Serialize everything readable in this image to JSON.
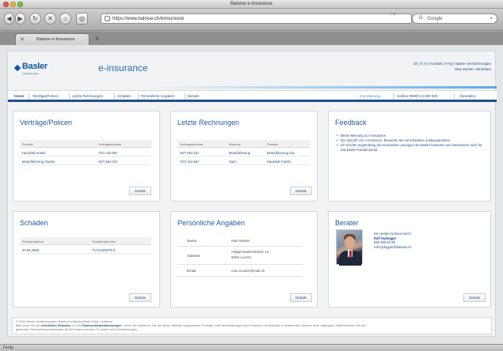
{
  "window": {
    "title": "Baloise e-Insurance"
  },
  "toolbar": {
    "url": "https://www.baloise.ch/einsurance",
    "search_engine": "G",
    "search_placeholder": "Google"
  },
  "tab": {
    "label": "Baloise e-Insurance"
  },
  "site": {
    "logo_word": "Basler",
    "logo_sub": "Versicherungen",
    "brand_title": "e-insurance",
    "toplinks_line1": "de | fr | it | Kontakt | FAQ | Basler Versicherungen",
    "toplinks_line2": "Max Muster, Abmelden"
  },
  "nav": {
    "items": [
      "Home",
      "Verträge/Policen",
      "Letzte Rechnungen",
      "Schäden",
      "Persönliche Angaben",
      "Berater"
    ],
    "right_items": [
      "Ihre Meinung",
      "Hotline 00800 24 800 800",
      "Abmelden"
    ]
  },
  "panels": {
    "vertraege": {
      "title": "Verträge/Policen",
      "headers": [
        "Produkt",
        "Vertragsnummer"
      ],
      "rows": [
        [
          "Haushalt Kombi",
          "70/1.234.567"
        ],
        [
          "Motorfahrzeug Classic",
          "40/7.654.321"
        ]
      ],
      "details": "Details"
    },
    "rechnungen": {
      "title": "Letzte Rechnungen",
      "headers": [
        "Vertragsnummer",
        "Branche",
        "Produkt"
      ],
      "rows": [
        [
          "40/7.654.321",
          "Motorfahrzeug",
          "Motorfahrzeug Cla..."
        ],
        [
          "70/1.234.567",
          "Sach",
          "Haushalt Combi"
        ]
      ],
      "details": "Details"
    },
    "feedback": {
      "title": "Feedback",
      "items": [
        "Meine Meinung zu e-insurance",
        "Die Zukunft von e-insurance. Bewerten Sie verschiedene Ausbauvarianten.",
        "Ich möchte regelmässig die innovativen Lösungen der Basler bewerten und interessiere mich für das Basler-Kundenportal."
      ]
    },
    "schaeden": {
      "title": "Schäden",
      "headers": [
        "Schadendatum",
        "Schadennummer"
      ],
      "rows": [
        [
          "30.06.2009",
          "71/123456/78.8"
        ]
      ],
      "details": "Details"
    },
    "persoenlich": {
      "title": "Persönliche Angaben",
      "rows": [
        {
          "label": "Name",
          "value": "Max Muster"
        },
        {
          "label": "Adresse",
          "value": "Adligenswilerstrasse 12",
          "value2": "6006 Luzern"
        },
        {
          "label": "Email",
          "value": "max.muster@mail.ch"
        }
      ],
      "details": "Details"
    },
    "berater": {
      "title": "Berater",
      "line1": "Sie werden betreut durch",
      "name": "Ralf Nydegger",
      "phone": "058 285 85 85",
      "email": "ralf.nydegger@baloise.ch",
      "details": "Details"
    }
  },
  "footer": {
    "line1": "© 2010 Basler Versicherungen, Basel und Baloise Bank SoBa, Solothurn",
    "line2_a": "Bitte lesen Sie die",
    "link1": "rechtlichen Hinweise",
    "line2_b": "und die",
    "link2": "Datenschutzbestimmungen",
    "line2_c": ", bevor Sie fortfahren. Die auf dieser Website angebotenen Produkte und Dienstleistungen sind Personen mit Wohnsitz in bestimmten Ländern nicht zugänglich. Bitte beachten Sie die",
    "line3": "geltenden Verkaufsbeschränkungen für die entsprechenden Produkte und Dienstleistungen."
  },
  "status": {
    "text": "Fertig"
  }
}
